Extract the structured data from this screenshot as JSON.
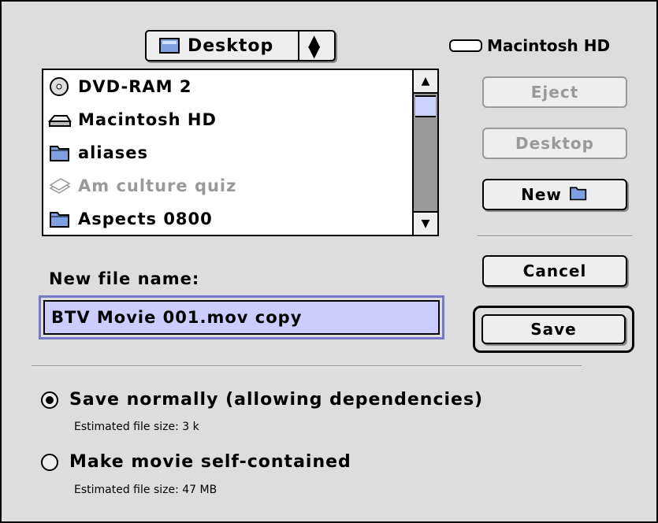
{
  "popup": {
    "label": "Desktop",
    "arrows": "⬍"
  },
  "volume": {
    "label": "Macintosh HD"
  },
  "file_list": [
    {
      "label": "DVD-RAM 2",
      "icon": "cd-icon",
      "dim": false
    },
    {
      "label": "Macintosh HD",
      "icon": "hard-disk-icon",
      "dim": false
    },
    {
      "label": "aliases",
      "icon": "folder-icon",
      "dim": false
    },
    {
      "label": "Am culture quiz",
      "icon": "stack-icon",
      "dim": true
    },
    {
      "label": "Aspects 0800",
      "icon": "folder-icon",
      "dim": false
    }
  ],
  "buttons": {
    "eject": "Eject",
    "desktop": "Desktop",
    "new": "New",
    "cancel": "Cancel",
    "save": "Save"
  },
  "filename": {
    "label": "New file name:",
    "value": "BTV Movie 001.mov copy"
  },
  "options": [
    {
      "label": "Save normally (allowing dependencies)",
      "sub": "Estimated file size: 3 k",
      "checked": true
    },
    {
      "label": "Make movie self-contained",
      "sub": "Estimated file size: 47 MB",
      "checked": false
    }
  ]
}
